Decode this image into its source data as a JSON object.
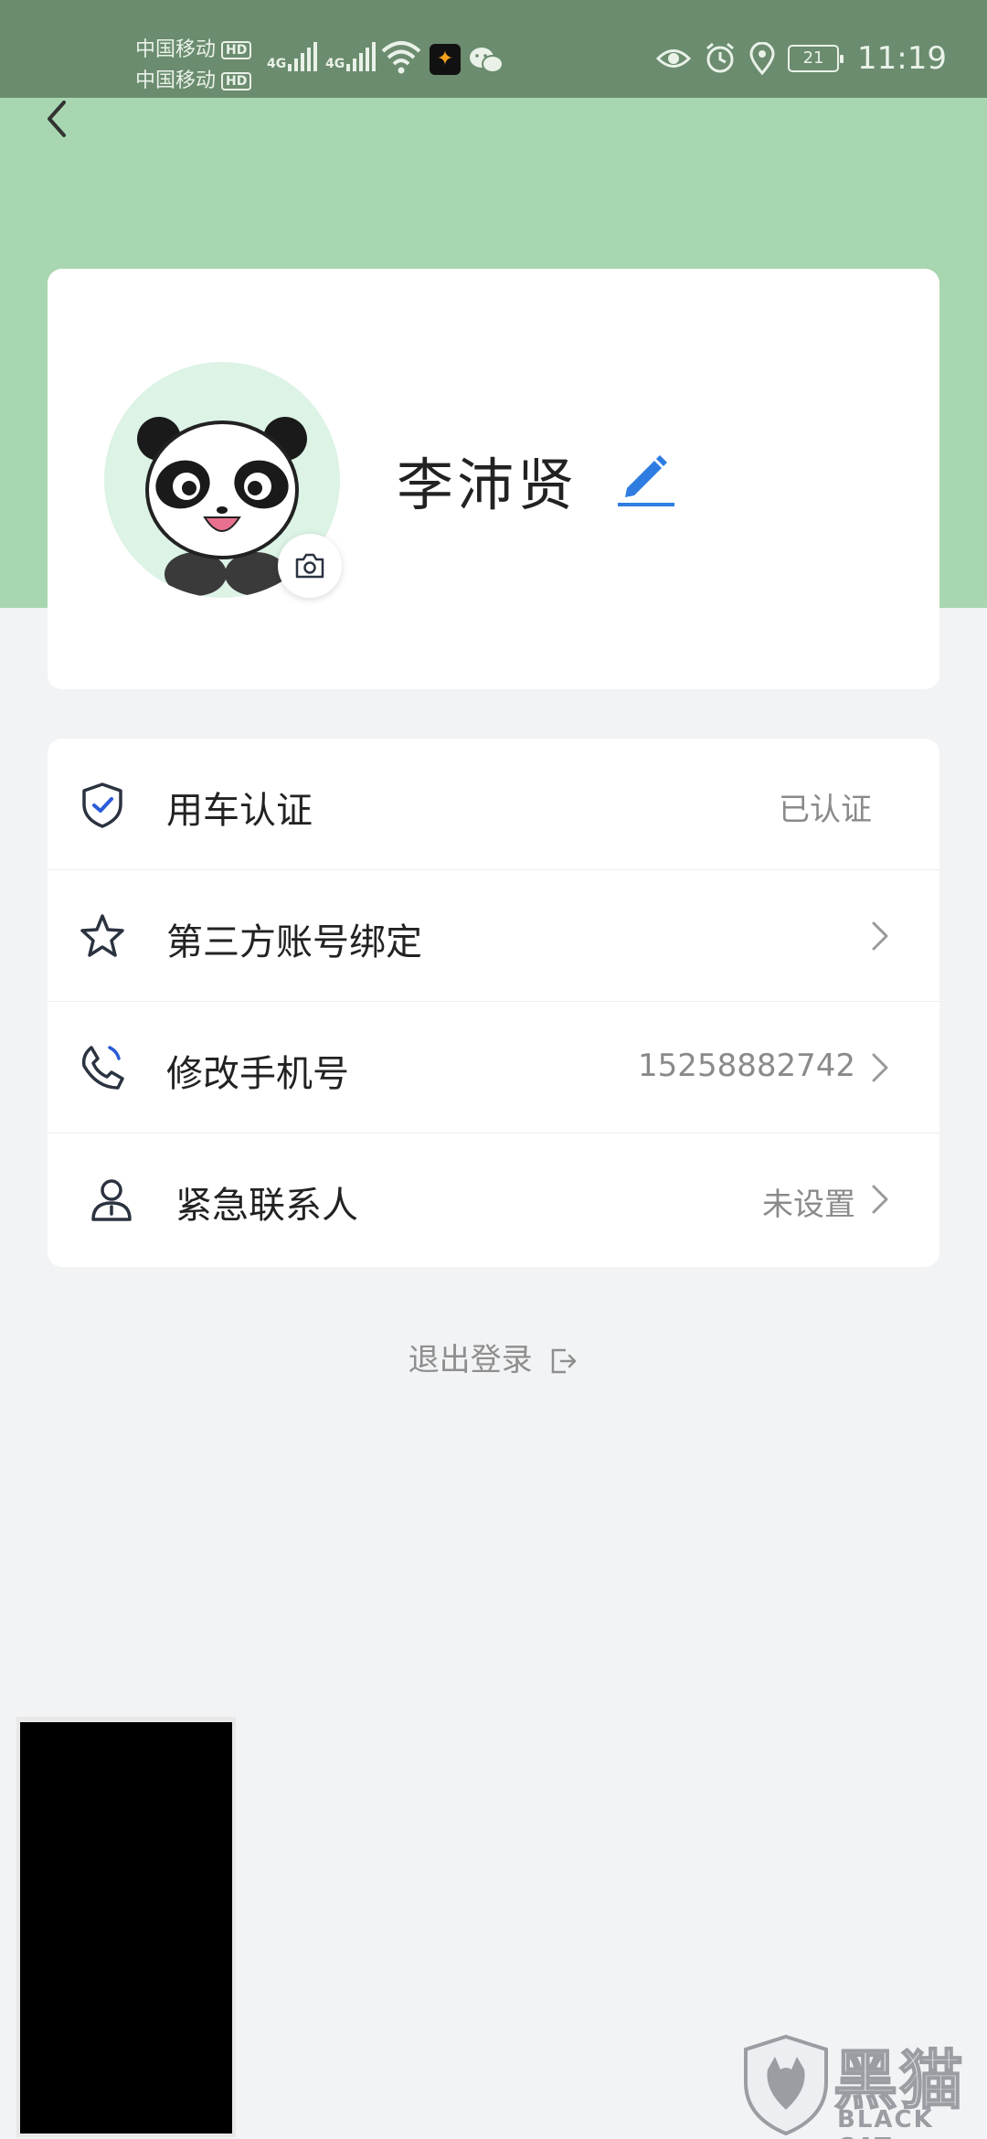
{
  "status_bar": {
    "carrier1": "中国移动",
    "carrier2": "中国移动",
    "hd": "HD",
    "network1": "4G",
    "network2": "4G",
    "battery": "21",
    "time": "11:19"
  },
  "colors": {
    "status_bar": "#6b8c6e",
    "header": "#a8d6b0",
    "accent_edit": "#2f7de1",
    "page_bg": "#f2f3f5"
  },
  "profile": {
    "name": "李沛贤",
    "avatar_icon": "panda-avatar",
    "camera_icon": "camera-icon",
    "edit_icon": "pencil-edit-icon"
  },
  "menu": [
    {
      "icon": "shield-check-icon",
      "label": "用车认证",
      "value": "已认证"
    },
    {
      "icon": "star-icon",
      "label": "第三方账号绑定",
      "value": ""
    },
    {
      "icon": "phone-icon",
      "label": "修改手机号",
      "value": "15258882742"
    },
    {
      "icon": "person-icon",
      "label": "紧急联系人",
      "value": "未设置"
    }
  ],
  "logout": {
    "label": "退出登录",
    "icon": "logout-icon"
  },
  "watermark": {
    "cn": "黑猫",
    "en": "BLACK CAT"
  }
}
